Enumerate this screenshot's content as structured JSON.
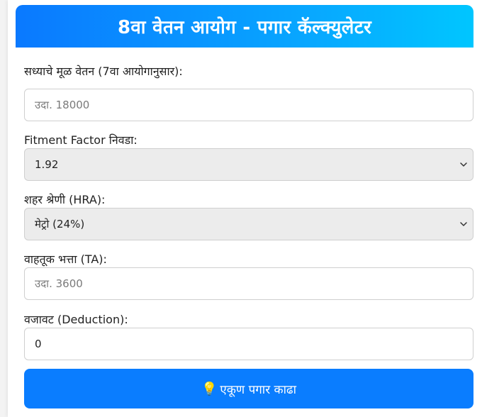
{
  "header": {
    "title": "8वा वेतन आयोग - पगार कॅल्क्युलेटर"
  },
  "form": {
    "basic_pay": {
      "label": "सध्याचे मूळ वेतन (7वा आयोगानुसार):",
      "placeholder": "उदा. 18000",
      "value": ""
    },
    "fitment": {
      "label": "Fitment Factor निवडा:",
      "selected": "1.92",
      "icon": "chevron-down-icon"
    },
    "city": {
      "label": "शहर श्रेणी (HRA):",
      "selected": "मेट्रो (24%)",
      "icon": "chevron-down-icon"
    },
    "ta": {
      "label": "वाहतूक भत्ता (TA):",
      "placeholder": "उदा. 3600",
      "value": ""
    },
    "deduction": {
      "label": "वजावट (Deduction):",
      "value": "0"
    }
  },
  "action": {
    "icon": "💡",
    "label": "एकूण पगार काढा"
  },
  "colors": {
    "accent": "#0a7dff",
    "header_gradient_start": "#0a79ff",
    "header_gradient_end": "#00c6ff"
  }
}
